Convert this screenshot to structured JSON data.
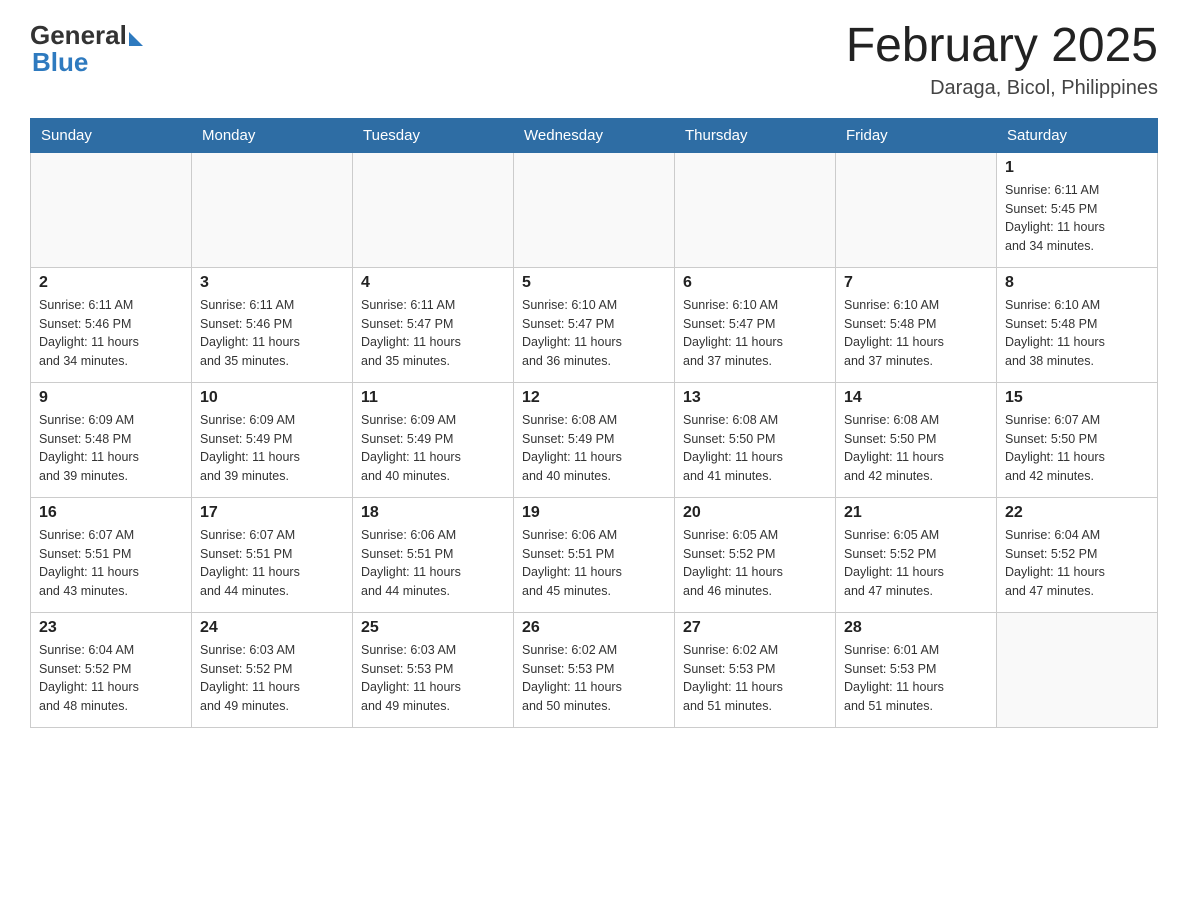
{
  "header": {
    "logo_general": "General",
    "logo_blue": "Blue",
    "title": "February 2025",
    "location": "Daraga, Bicol, Philippines"
  },
  "days_of_week": [
    "Sunday",
    "Monday",
    "Tuesday",
    "Wednesday",
    "Thursday",
    "Friday",
    "Saturday"
  ],
  "weeks": [
    [
      {
        "day": "",
        "info": ""
      },
      {
        "day": "",
        "info": ""
      },
      {
        "day": "",
        "info": ""
      },
      {
        "day": "",
        "info": ""
      },
      {
        "day": "",
        "info": ""
      },
      {
        "day": "",
        "info": ""
      },
      {
        "day": "1",
        "info": "Sunrise: 6:11 AM\nSunset: 5:45 PM\nDaylight: 11 hours\nand 34 minutes."
      }
    ],
    [
      {
        "day": "2",
        "info": "Sunrise: 6:11 AM\nSunset: 5:46 PM\nDaylight: 11 hours\nand 34 minutes."
      },
      {
        "day": "3",
        "info": "Sunrise: 6:11 AM\nSunset: 5:46 PM\nDaylight: 11 hours\nand 35 minutes."
      },
      {
        "day": "4",
        "info": "Sunrise: 6:11 AM\nSunset: 5:47 PM\nDaylight: 11 hours\nand 35 minutes."
      },
      {
        "day": "5",
        "info": "Sunrise: 6:10 AM\nSunset: 5:47 PM\nDaylight: 11 hours\nand 36 minutes."
      },
      {
        "day": "6",
        "info": "Sunrise: 6:10 AM\nSunset: 5:47 PM\nDaylight: 11 hours\nand 37 minutes."
      },
      {
        "day": "7",
        "info": "Sunrise: 6:10 AM\nSunset: 5:48 PM\nDaylight: 11 hours\nand 37 minutes."
      },
      {
        "day": "8",
        "info": "Sunrise: 6:10 AM\nSunset: 5:48 PM\nDaylight: 11 hours\nand 38 minutes."
      }
    ],
    [
      {
        "day": "9",
        "info": "Sunrise: 6:09 AM\nSunset: 5:48 PM\nDaylight: 11 hours\nand 39 minutes."
      },
      {
        "day": "10",
        "info": "Sunrise: 6:09 AM\nSunset: 5:49 PM\nDaylight: 11 hours\nand 39 minutes."
      },
      {
        "day": "11",
        "info": "Sunrise: 6:09 AM\nSunset: 5:49 PM\nDaylight: 11 hours\nand 40 minutes."
      },
      {
        "day": "12",
        "info": "Sunrise: 6:08 AM\nSunset: 5:49 PM\nDaylight: 11 hours\nand 40 minutes."
      },
      {
        "day": "13",
        "info": "Sunrise: 6:08 AM\nSunset: 5:50 PM\nDaylight: 11 hours\nand 41 minutes."
      },
      {
        "day": "14",
        "info": "Sunrise: 6:08 AM\nSunset: 5:50 PM\nDaylight: 11 hours\nand 42 minutes."
      },
      {
        "day": "15",
        "info": "Sunrise: 6:07 AM\nSunset: 5:50 PM\nDaylight: 11 hours\nand 42 minutes."
      }
    ],
    [
      {
        "day": "16",
        "info": "Sunrise: 6:07 AM\nSunset: 5:51 PM\nDaylight: 11 hours\nand 43 minutes."
      },
      {
        "day": "17",
        "info": "Sunrise: 6:07 AM\nSunset: 5:51 PM\nDaylight: 11 hours\nand 44 minutes."
      },
      {
        "day": "18",
        "info": "Sunrise: 6:06 AM\nSunset: 5:51 PM\nDaylight: 11 hours\nand 44 minutes."
      },
      {
        "day": "19",
        "info": "Sunrise: 6:06 AM\nSunset: 5:51 PM\nDaylight: 11 hours\nand 45 minutes."
      },
      {
        "day": "20",
        "info": "Sunrise: 6:05 AM\nSunset: 5:52 PM\nDaylight: 11 hours\nand 46 minutes."
      },
      {
        "day": "21",
        "info": "Sunrise: 6:05 AM\nSunset: 5:52 PM\nDaylight: 11 hours\nand 47 minutes."
      },
      {
        "day": "22",
        "info": "Sunrise: 6:04 AM\nSunset: 5:52 PM\nDaylight: 11 hours\nand 47 minutes."
      }
    ],
    [
      {
        "day": "23",
        "info": "Sunrise: 6:04 AM\nSunset: 5:52 PM\nDaylight: 11 hours\nand 48 minutes."
      },
      {
        "day": "24",
        "info": "Sunrise: 6:03 AM\nSunset: 5:52 PM\nDaylight: 11 hours\nand 49 minutes."
      },
      {
        "day": "25",
        "info": "Sunrise: 6:03 AM\nSunset: 5:53 PM\nDaylight: 11 hours\nand 49 minutes."
      },
      {
        "day": "26",
        "info": "Sunrise: 6:02 AM\nSunset: 5:53 PM\nDaylight: 11 hours\nand 50 minutes."
      },
      {
        "day": "27",
        "info": "Sunrise: 6:02 AM\nSunset: 5:53 PM\nDaylight: 11 hours\nand 51 minutes."
      },
      {
        "day": "28",
        "info": "Sunrise: 6:01 AM\nSunset: 5:53 PM\nDaylight: 11 hours\nand 51 minutes."
      },
      {
        "day": "",
        "info": ""
      }
    ]
  ]
}
